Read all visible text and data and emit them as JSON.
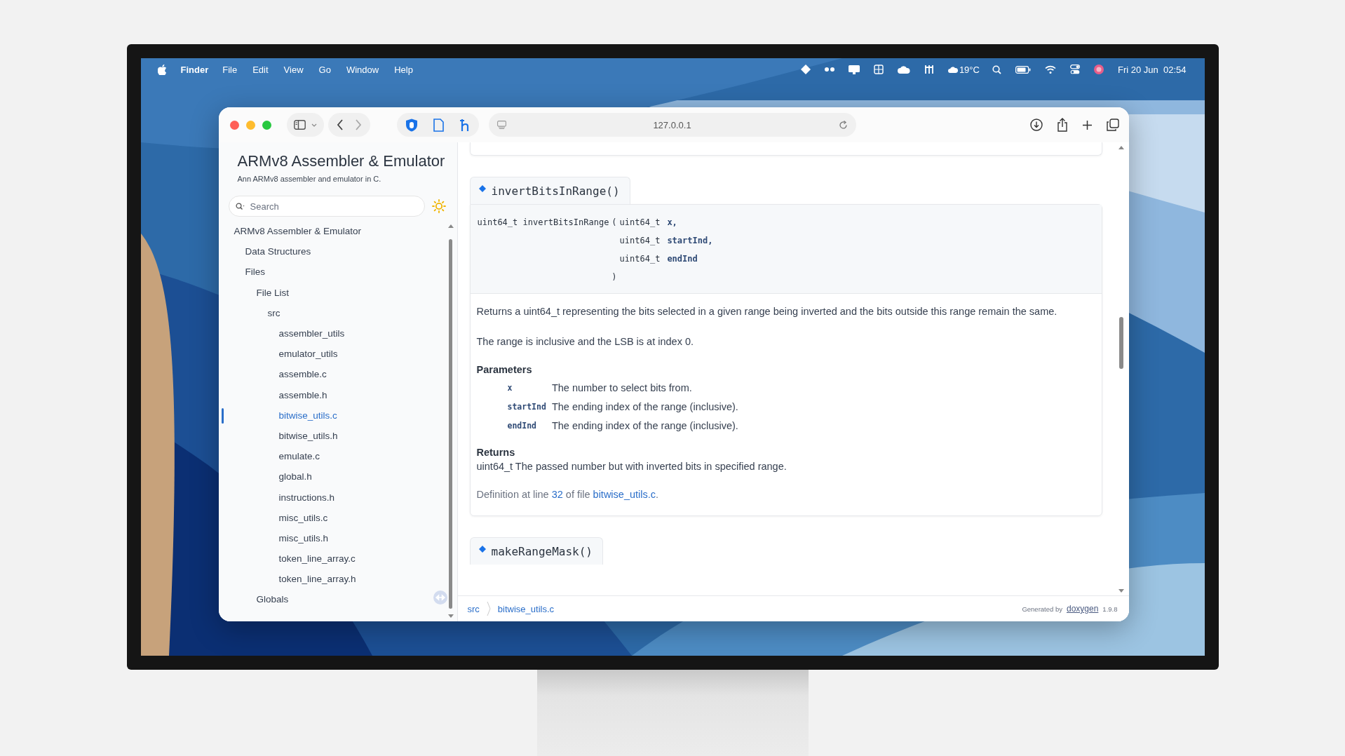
{
  "menu_bar": {
    "app": "Finder",
    "menus": [
      "File",
      "Edit",
      "View",
      "Go",
      "Window",
      "Help"
    ],
    "temperature": "19°C",
    "clock": "Fri 20 Jun  02:54"
  },
  "browser": {
    "address": "127.0.0.1"
  },
  "sidebar": {
    "title": "ARMv8 Assembler & Emulator",
    "subtitle": "Ann ARMv8 assembler and emulator in C.",
    "search": {
      "placeholder": "Search"
    },
    "tree": [
      {
        "label": "ARMv8 Assembler & Emulator",
        "selected": false,
        "children": [
          {
            "label": "Data Structures",
            "selected": false
          },
          {
            "label": "Files",
            "selected": false,
            "children": [
              {
                "label": "File List",
                "selected": false,
                "children": [
                  {
                    "label": "src",
                    "selected": false,
                    "children": [
                      {
                        "label": "assembler_utils",
                        "selected": false
                      },
                      {
                        "label": "emulator_utils",
                        "selected": false
                      },
                      {
                        "label": "assemble.c",
                        "selected": false
                      },
                      {
                        "label": "assemble.h",
                        "selected": false
                      },
                      {
                        "label": "bitwise_utils.c",
                        "selected": true
                      },
                      {
                        "label": "bitwise_utils.h",
                        "selected": false
                      },
                      {
                        "label": "emulate.c",
                        "selected": false
                      },
                      {
                        "label": "global.h",
                        "selected": false
                      },
                      {
                        "label": "instructions.h",
                        "selected": false
                      },
                      {
                        "label": "misc_utils.c",
                        "selected": false
                      },
                      {
                        "label": "misc_utils.h",
                        "selected": false
                      },
                      {
                        "label": "token_line_array.c",
                        "selected": false
                      },
                      {
                        "label": "token_line_array.h",
                        "selected": false
                      }
                    ]
                  }
                ]
              },
              {
                "label": "Globals",
                "selected": false
              }
            ]
          }
        ]
      }
    ]
  },
  "content": {
    "members": [
      {
        "name": "invertBitsInRange()",
        "prototype": {
          "return_type": "uint64_t",
          "function": "invertBitsInRange",
          "open": "(",
          "close": ")",
          "params": [
            {
              "type": "uint64_t",
              "name": "x,"
            },
            {
              "type": "uint64_t",
              "name": "startInd,"
            },
            {
              "type": "uint64_t",
              "name": "endInd"
            }
          ]
        },
        "description": [
          "Returns a uint64_t representing the bits selected in a given range being inverted and the bits outside this range remain the same.",
          "The range is inclusive and the LSB is at index 0."
        ],
        "parameters_heading": "Parameters",
        "parameters": [
          {
            "name": "x",
            "text": "The number to select bits from."
          },
          {
            "name": "startInd",
            "text": "The ending index of the range (inclusive)."
          },
          {
            "name": "endInd",
            "text": "The ending index of the range (inclusive)."
          }
        ],
        "returns_heading": "Returns",
        "returns": "uint64_t The passed number but with inverted bits in specified range.",
        "definition": {
          "prefix": "Definition at line",
          "line": "32",
          "middle": "of file",
          "file": "bitwise_utils.c",
          "suffix": "."
        }
      },
      {
        "name": "makeRangeMask()"
      }
    ]
  },
  "footer": {
    "breadcrumb": [
      "src",
      "bitwise_utils.c"
    ],
    "generated_by": "Generated by",
    "generator": "doxygen",
    "version": "1.9.8"
  }
}
